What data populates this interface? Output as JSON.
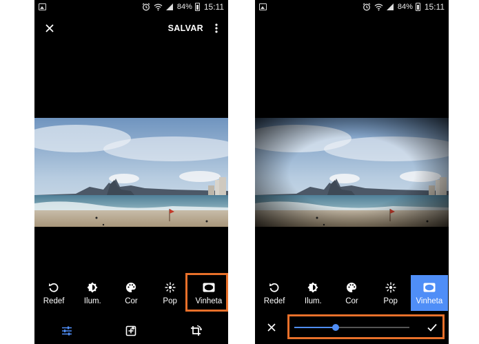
{
  "status_bar": {
    "battery": "84%",
    "time": "15:11"
  },
  "header": {
    "save_label": "SALVAR"
  },
  "tools": [
    {
      "label": "Redef",
      "icon": "rotate-icon"
    },
    {
      "label": "Ilum.",
      "icon": "brightness-icon"
    },
    {
      "label": "Cor",
      "icon": "palette-icon"
    },
    {
      "label": "Pop",
      "icon": "sparkle-icon"
    },
    {
      "label": "Vinheta",
      "icon": "vignette-icon"
    }
  ],
  "selected_tool": "Vinheta",
  "bottom_nav": [
    "sliders-icon",
    "auto-enhance-icon",
    "crop-rotate-icon"
  ],
  "vignette_slider": {
    "value": 0.36
  },
  "colors": {
    "accent": "#4f8ef7",
    "highlight": "#e8702a",
    "background": "#000000"
  }
}
